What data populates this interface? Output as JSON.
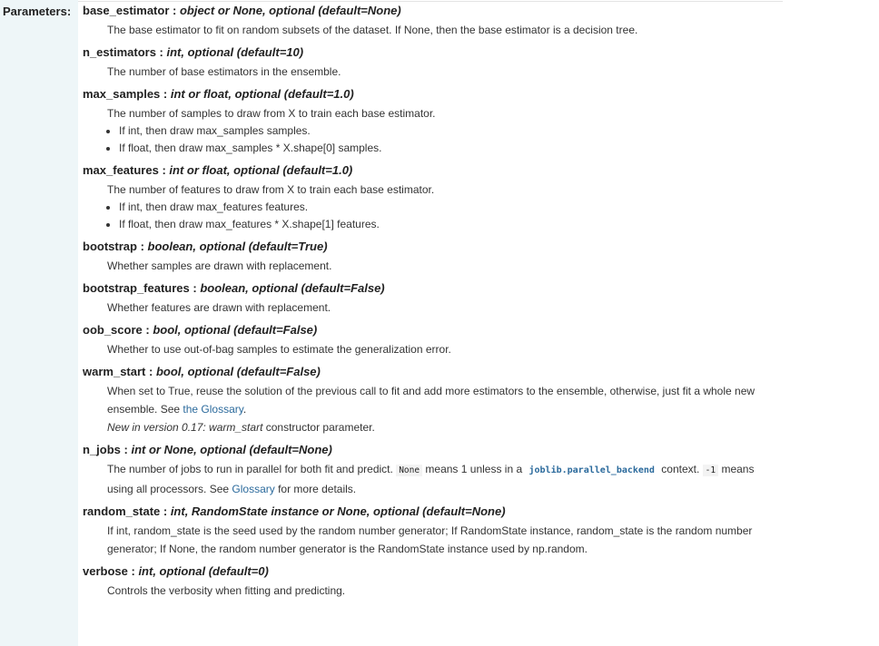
{
  "section_label": "Parameters:",
  "params": [
    {
      "name": "base_estimator",
      "type": "object or None, optional (default=None)",
      "desc": "The base estimator to fit on random subsets of the dataset. If None, then the base estimator is a decision tree."
    },
    {
      "name": "n_estimators",
      "type": "int, optional (default=10)",
      "desc": "The number of base estimators in the ensemble."
    },
    {
      "name": "max_samples",
      "type": "int or float, optional (default=1.0)",
      "desc": "The number of samples to draw from X to train each base estimator.",
      "bullets": [
        "If int, then draw max_samples samples.",
        "If float, then draw max_samples * X.shape[0] samples."
      ]
    },
    {
      "name": "max_features",
      "type": "int or float, optional (default=1.0)",
      "desc": "The number of features to draw from X to train each base estimator.",
      "bullets": [
        "If int, then draw max_features features.",
        "If float, then draw max_features * X.shape[1] features."
      ]
    },
    {
      "name": "bootstrap",
      "type": "boolean, optional (default=True)",
      "desc": "Whether samples are drawn with replacement."
    },
    {
      "name": "bootstrap_features",
      "type": "boolean, optional (default=False)",
      "desc": "Whether features are drawn with replacement."
    },
    {
      "name": "oob_score",
      "type": "bool, optional (default=False)",
      "desc": "Whether to use out-of-bag samples to estimate the generalization error."
    },
    {
      "name": "warm_start",
      "type": "bool, optional (default=False)",
      "desc_prefix": "When set to True, reuse the solution of the previous call to fit and add more estimators to the ensemble, otherwise, just fit a whole new ensemble. See ",
      "desc_link": "the Glossary",
      "desc_suffix": ".",
      "note_italic": "New in version 0.17: warm_start",
      "note_rest": " constructor parameter."
    },
    {
      "name": "n_jobs",
      "type": "int or None, optional (default=None)",
      "desc_a": "The number of jobs to run in parallel for both fit and predict. ",
      "code_none": "None",
      "desc_b": " means 1 unless in a ",
      "code_backend": "joblib.parallel_backend",
      "desc_c": " context. ",
      "code_minus1": "-1",
      "desc_d": " means using all processors. See ",
      "link": "Glossary",
      "desc_e": " for more details."
    },
    {
      "name": "random_state",
      "type": "int, RandomState instance or None, optional (default=None)",
      "desc": "If int, random_state is the seed used by the random number generator; If RandomState instance, random_state is the random number generator; If None, the random number generator is the RandomState instance used by np.random."
    },
    {
      "name": "verbose",
      "type": "int, optional (default=0)",
      "desc": "Controls the verbosity when fitting and predicting."
    }
  ]
}
